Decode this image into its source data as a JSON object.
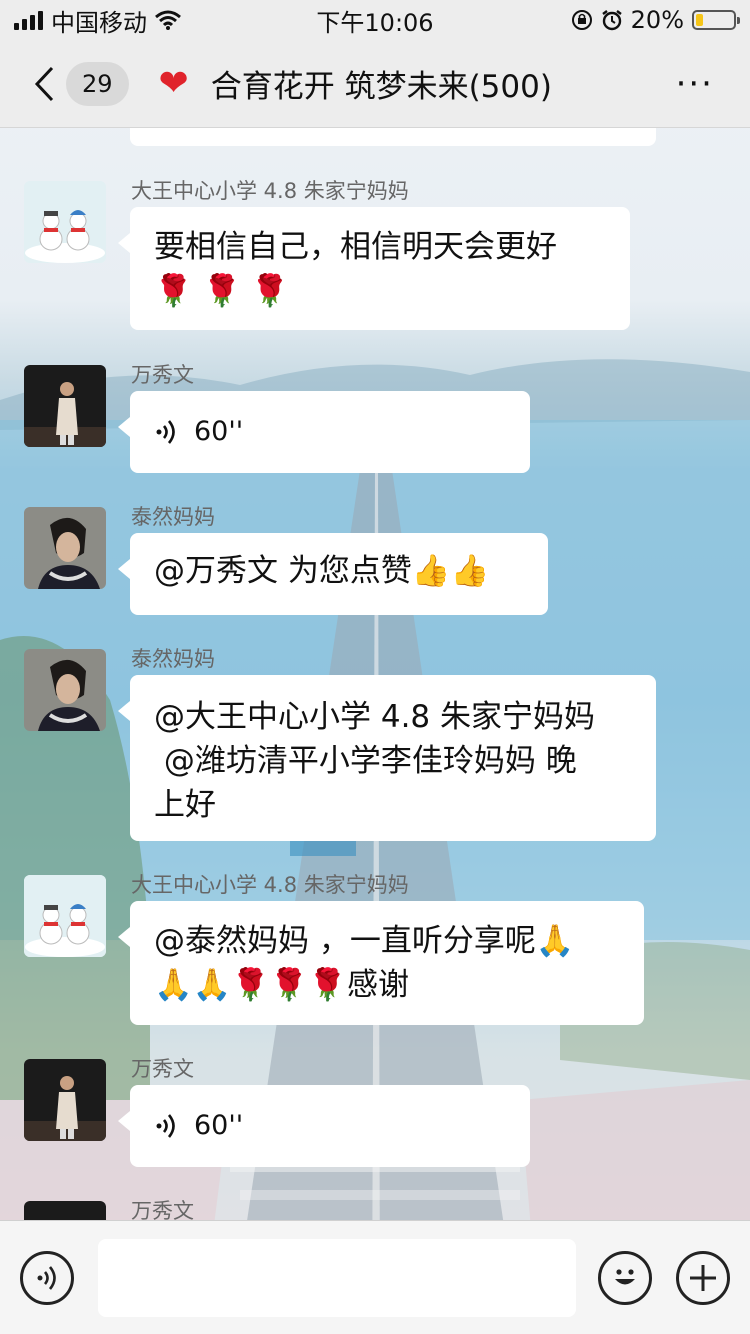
{
  "status_bar": {
    "carrier": "中国移动",
    "time": "下午10:06",
    "battery_percent": "20%",
    "battery_level": 0.2
  },
  "header": {
    "unread_count": "29",
    "title": "合育花开 筑梦未来(500)",
    "more_label": "···"
  },
  "messages": [
    {
      "sender": "大王中心小学 4.8 朱家宁妈妈",
      "avatar": "snowman-avatar",
      "type": "text",
      "line1": "要相信自己，相信明天会更好",
      "line2": "🌹 🌹 🌹"
    },
    {
      "sender": "万秀文",
      "avatar": "man-avatar",
      "type": "voice",
      "duration": "60''"
    },
    {
      "sender": "泰然妈妈",
      "avatar": "woman-avatar",
      "type": "text",
      "line1": "@万秀文 为您点赞👍👍"
    },
    {
      "sender": "泰然妈妈",
      "avatar": "woman-avatar",
      "type": "text",
      "line1": "@大王中心小学 4.8 朱家宁妈妈",
      "line2": " @潍坊清平小学李佳玲妈妈 晚",
      "line3": "上好"
    },
    {
      "sender": "大王中心小学 4.8 朱家宁妈妈",
      "avatar": "snowman-avatar",
      "type": "text",
      "line1": "@泰然妈妈 ，一直听分享呢🙏",
      "line2": "🙏🙏🌹🌹🌹感谢"
    },
    {
      "sender": "万秀文",
      "avatar": "man-avatar",
      "type": "voice",
      "duration": "60''"
    },
    {
      "sender": "万秀文",
      "avatar": "man-avatar",
      "type": "partial"
    }
  ],
  "input_bar": {
    "placeholder": ""
  },
  "colors": {
    "header_bg": "#ededed",
    "bubble_bg": "#ffffff",
    "heart": "#e0232b",
    "battery": "#f5c518"
  }
}
